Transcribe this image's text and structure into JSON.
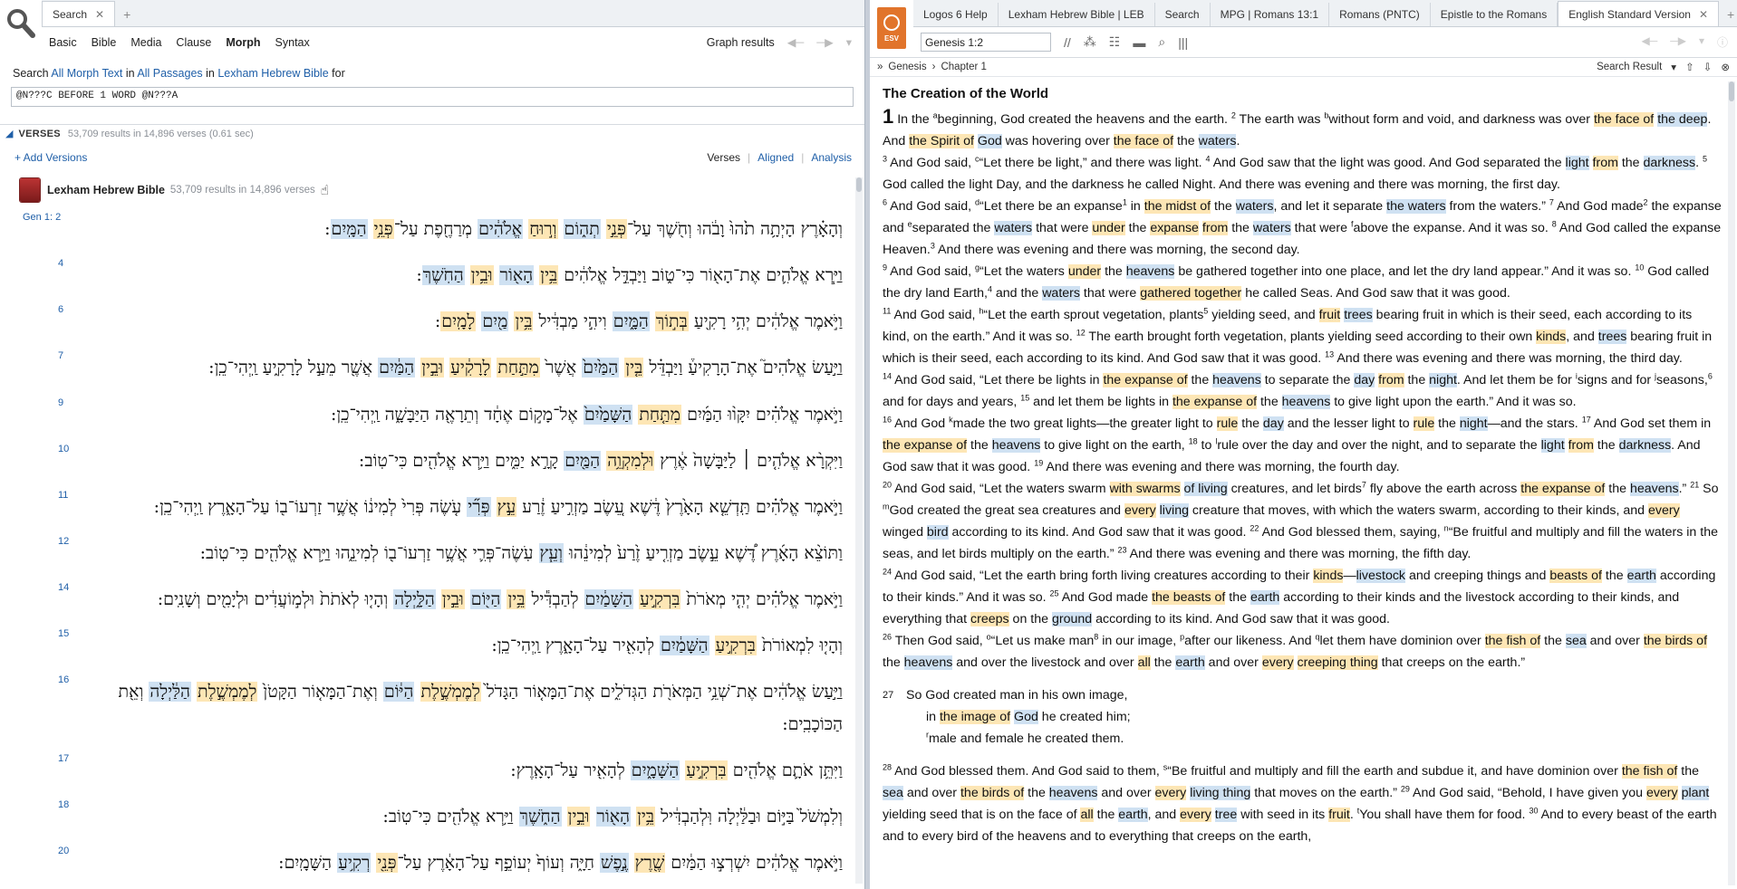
{
  "left": {
    "tabs": [
      {
        "label": "Search",
        "active": true
      }
    ],
    "modes": [
      "Basic",
      "Bible",
      "Media",
      "Clause",
      "Morph",
      "Syntax"
    ],
    "active_mode": "Morph",
    "graph_results": "Graph results",
    "search_line": {
      "prefix": "Search",
      "text": "All Morph Text",
      "in1": "in",
      "passages": "All Passages",
      "in2": "in",
      "bible": "Lexham Hebrew Bible",
      "suffix": "for"
    },
    "query": "@N???C BEFORE 1 WORD @N???A",
    "verses_header": {
      "label": "VERSES",
      "summary": "53,709 results in 14,896 verses (0.61 sec)"
    },
    "add_versions": "+ Add Versions",
    "view_options": [
      "Verses",
      "Aligned",
      "Analysis"
    ],
    "book": {
      "title": "Lexham Hebrew Bible",
      "count": "53,709 results in 14,896 verses"
    },
    "verses": [
      {
        "num": "Gen 1:  2",
        "parts": [
          [
            "n",
            "וְהָאָ֗רֶץ הָיְתָ֥ה תֹ֙הוּ֙ וָבֹ֔הוּ וְחֹ֖שֶׁךְ עַל־"
          ],
          [
            "y",
            "פְּנֵ֣י"
          ],
          [
            "n",
            " "
          ],
          [
            "b",
            "תְה֑וֹם"
          ],
          [
            "n",
            " "
          ],
          [
            "y",
            "וְר֣וּחַ"
          ],
          [
            "n",
            " "
          ],
          [
            "b",
            "אֱלֹהִ֔ים"
          ],
          [
            "n",
            " מְרַחֶ֖פֶת עַל־"
          ],
          [
            "y",
            "פְּנֵ֥י"
          ],
          [
            "n",
            " "
          ],
          [
            "b",
            "הַמָּֽיִם"
          ],
          [
            "n",
            ":"
          ]
        ]
      },
      {
        "num": "4",
        "parts": [
          [
            "n",
            "וַיַּ֧רְא אֱלֹהִ֛ים אֶת־הָא֖וֹר כִּי־ט֑וֹב וַיַּבְדֵּ֣ל אֱלֹהִ֔ים "
          ],
          [
            "y",
            "בֵּ֥ין"
          ],
          [
            "n",
            " "
          ],
          [
            "b",
            "הָא֖וֹר"
          ],
          [
            "n",
            " "
          ],
          [
            "y",
            "וּבֵ֥ין"
          ],
          [
            "n",
            " "
          ],
          [
            "b",
            "הַחֹֽשֶׁךְ"
          ],
          [
            "n",
            ":"
          ]
        ]
      },
      {
        "num": "6",
        "parts": [
          [
            "n",
            "וַיֹּ֣אמֶר אֱלֹהִ֔ים יְהִ֥י רָקִ֖יעַ "
          ],
          [
            "y",
            "בְּת֣וֹךְ"
          ],
          [
            "n",
            " "
          ],
          [
            "b",
            "הַמָּ֑יִם"
          ],
          [
            "n",
            " וִיהִ֣י מַבְדִּ֔יל "
          ],
          [
            "y",
            "בֵּ֥ין"
          ],
          [
            "n",
            " "
          ],
          [
            "b",
            "מַ֖יִם"
          ],
          [
            "n",
            " "
          ],
          [
            "y",
            "לָמָֽיִם"
          ],
          [
            "n",
            ":"
          ]
        ]
      },
      {
        "num": "7",
        "parts": [
          [
            "n",
            "וַיַּ֣עַשׂ אֱלֹהִים֮ אֶת־הָרָקִיעַ֒ וַיַּבְדֵּ֗ל "
          ],
          [
            "y",
            "בֵּ֤ין"
          ],
          [
            "n",
            " "
          ],
          [
            "b",
            "הַמַּ֙יִם֙"
          ],
          [
            "n",
            " אֲשֶׁר֙ "
          ],
          [
            "y",
            "מִתַּ֣חַת"
          ],
          [
            "n",
            " "
          ],
          [
            "y",
            "לָרָקִ֔יעַ"
          ],
          [
            "n",
            " "
          ],
          [
            "y",
            "וּבֵ֣ין"
          ],
          [
            "n",
            " "
          ],
          [
            "b",
            "הַמַּ֔יִם"
          ],
          [
            "n",
            " אֲשֶׁ֖ר מֵעַ֣ל לָרָקִ֑יעַ וַֽיְהִי־כֵֽן"
          ],
          [
            "n",
            ":"
          ]
        ]
      },
      {
        "num": "9",
        "parts": [
          [
            "n",
            "וַיֹּ֣אמֶר אֱלֹהִ֗ים יִקָּו֨וּ הַמַּ֜יִם "
          ],
          [
            "y",
            "מִתַּ֤חַת"
          ],
          [
            "n",
            " "
          ],
          [
            "b",
            "הַשָּׁמַ֙יִם֙"
          ],
          [
            "n",
            " אֶל־מָק֣וֹם אֶחָ֔ד וְתֵרָאֶ֖ה הַיַּבָּשָׁ֑ה וַֽיְהִי־כֵֽן"
          ],
          [
            "n",
            ":"
          ]
        ]
      },
      {
        "num": "10",
        "parts": [
          [
            "n",
            "וַיִּקְרָ֨א אֱלֹהִ֤ים ׀ לַיַּבָּשָׁה֙ אֶ֔רֶץ "
          ],
          [
            "y",
            "וּלְמִקְוֵ֥ה"
          ],
          [
            "n",
            " "
          ],
          [
            "b",
            "הַמַּ֖יִם"
          ],
          [
            "n",
            " קָרָ֣א יַמִּ֑ים וַיַּ֥רְא אֱלֹהִ֖ים כִּי־טֽוֹב"
          ],
          [
            "n",
            ":"
          ]
        ]
      },
      {
        "num": "11",
        "parts": [
          [
            "n",
            "וַיֹּ֣אמֶר אֱלֹהִ֗ים תַּֽדְשֵׁ֤א הָאָ֙רֶץ֙ דֶּ֔שֶׁא עֵ֚שֶׂב מַזְרִ֣יעַ זֶ֔רַע "
          ],
          [
            "y",
            "עֵ֣ץ"
          ],
          [
            "n",
            " "
          ],
          [
            "b",
            "פְּרִ֞י"
          ],
          [
            "n",
            " עֹ֤שֶׂה פְּרִי֙ לְמִינ֔וֹ אֲשֶׁ֥ר זַרְעוֹ־ב֖וֹ עַל־הָאָ֑רֶץ וַֽיְהִי־כֵֽן"
          ],
          [
            "n",
            ":"
          ]
        ]
      },
      {
        "num": "12",
        "parts": [
          [
            "n",
            "וַתּוֹצֵ֨א הָאָ֜רֶץ דֶּ֠שֶׁא עֵ֣שֶׂב מַזְרִ֤יעַ זֶ֙רַע֙ לְמִינֵ֔הוּ "
          ],
          [
            "b",
            "וְעֵ֧ץ"
          ],
          [
            "n",
            " עֹֽשֶׂה־פְּרִ֛י אֲשֶׁ֥ר זַרְעוֹ־ב֖וֹ לְמִינֵ֑הוּ וַיַּ֥רְא אֱלֹהִ֖ים כִּי־טֽוֹב"
          ],
          [
            "n",
            ":"
          ]
        ]
      },
      {
        "num": "14",
        "parts": [
          [
            "n",
            "וַיֹּ֣אמֶר אֱלֹהִ֗ים יְהִ֤י מְאֹרֹת֙ "
          ],
          [
            "y",
            "בִּרְקִ֣יעַ"
          ],
          [
            "n",
            " "
          ],
          [
            "b",
            "הַשָּׁמַ֔יִם"
          ],
          [
            "n",
            " לְהַבְדִּ֕יל "
          ],
          [
            "y",
            "בֵּ֥ין"
          ],
          [
            "n",
            " "
          ],
          [
            "b",
            "הַיּ֖וֹם"
          ],
          [
            "n",
            " "
          ],
          [
            "y",
            "וּבֵ֣ין"
          ],
          [
            "n",
            " "
          ],
          [
            "b",
            "הַלָּ֑יְלָה"
          ],
          [
            "n",
            " וְהָי֤וּ לְאֹתֹת֙ וּלְמ֣וֹעֲדִ֔ים וּלְיָמִ֖ים וְשָׁנִֽים"
          ],
          [
            "n",
            ":"
          ]
        ]
      },
      {
        "num": "15",
        "parts": [
          [
            "n",
            "וְהָי֤וּ לִמְאוֹרֹת֙ "
          ],
          [
            "y",
            "בִּרְקִ֣יעַ"
          ],
          [
            "n",
            " "
          ],
          [
            "b",
            "הַשָּׁמַ֔יִם"
          ],
          [
            "n",
            " לְהָאִ֖יר עַל־הָאָ֑רֶץ וַֽיְהִי־כֵֽן"
          ],
          [
            "n",
            ":"
          ]
        ]
      },
      {
        "num": "16",
        "parts": [
          [
            "n",
            "וַיַּ֣עַשׂ אֱלֹהִ֔ים אֶת־שְׁנֵ֥י הַמְּאֹרֹ֖ת הַגְּדֹלִ֑ים אֶת־הַמָּא֤וֹר הַגָּדֹל֙ "
          ],
          [
            "y",
            "לְמֶמְשֶׁ֣לֶת"
          ],
          [
            "n",
            " "
          ],
          [
            "b",
            "הַיּ֔וֹם"
          ],
          [
            "n",
            " וְאֶת־הַמָּא֤וֹר הַקָּטֹן֙ "
          ],
          [
            "y",
            "לְמֶמְשֶׁ֣לֶת"
          ],
          [
            "n",
            " "
          ],
          [
            "b",
            "הַלַּ֔יְלָה"
          ],
          [
            "n",
            " וְאֵ֖ת הַכּוֹכָבִֽים"
          ],
          [
            "n",
            ":"
          ]
        ]
      },
      {
        "num": "17",
        "parts": [
          [
            "n",
            "וַיִּתֵּ֥ן אֹתָ֛ם אֱלֹהִ֖ים "
          ],
          [
            "y",
            "בִּרְקִ֣יעַ"
          ],
          [
            "n",
            " "
          ],
          [
            "b",
            "הַשָּׁמָ֑יִם"
          ],
          [
            "n",
            " לְהָאִ֖יר עַל־הָאָֽרֶץ"
          ],
          [
            "n",
            ":"
          ]
        ]
      },
      {
        "num": "18",
        "parts": [
          [
            "n",
            "וְלִמְשֹׁל֙ בַּיּ֣וֹם וּבַלַּ֔יְלָה וּֽלְהַבְדִּ֔יל "
          ],
          [
            "y",
            "בֵּ֥ין"
          ],
          [
            "n",
            " "
          ],
          [
            "b",
            "הָא֖וֹר"
          ],
          [
            "n",
            " "
          ],
          [
            "y",
            "וּבֵ֣ין"
          ],
          [
            "n",
            " "
          ],
          [
            "b",
            "הַחֹ֑שֶׁךְ"
          ],
          [
            "n",
            " וַיַּ֥רְא אֱלֹהִ֖ים כִּי־טֽוֹב"
          ],
          [
            "n",
            ":"
          ]
        ]
      },
      {
        "num": "20",
        "parts": [
          [
            "n",
            "וַיֹּ֣אמֶר אֱלֹהִ֔ים יִשְׁרְצ֣וּ הַמַּ֔יִם "
          ],
          [
            "y",
            "שֶׁ֖רֶץ"
          ],
          [
            "n",
            " "
          ],
          [
            "b",
            "נֶ֣פֶשׁ"
          ],
          [
            "n",
            " חַיָּ֑ה וְעוֹף֙ יְעוֹפֵ֣ף עַל־הָאָ֔רֶץ עַל־"
          ],
          [
            "y",
            "פְּנֵ֖י"
          ],
          [
            "n",
            " "
          ],
          [
            "b",
            "רְקִ֥יעַ"
          ],
          [
            "n",
            " הַשָּׁמָֽיִם"
          ],
          [
            "n",
            ":"
          ]
        ]
      }
    ]
  },
  "right": {
    "tabs": [
      "Logos 6 Help",
      "Lexham Hebrew Bible | LEB",
      "Search",
      "MPG | Romans 13:1",
      "Romans (PNTC)",
      "Epistle to the Romans",
      "English Standard Version"
    ],
    "active_tab": "English Standard Version",
    "logo_text": "ESV",
    "reference": "Genesis 1:2",
    "crumbs": [
      "Genesis",
      "Chapter 1"
    ],
    "search_result": "Search Result",
    "heading": "The Creation of the World",
    "chapter": "1"
  }
}
